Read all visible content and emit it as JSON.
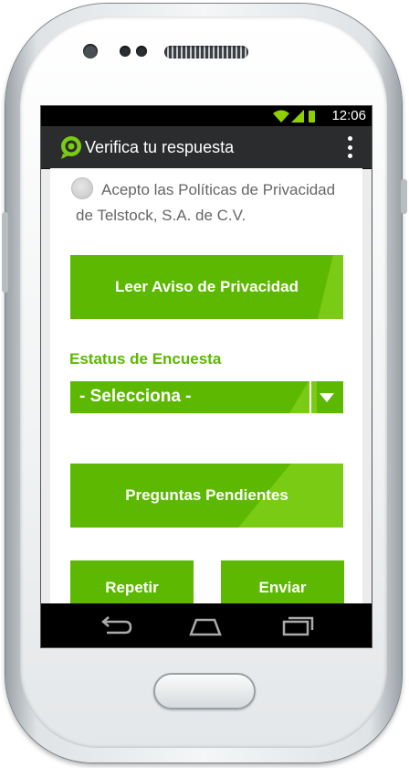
{
  "status_bar": {
    "time": "12:06"
  },
  "action_bar": {
    "title": "Verifica tu respuesta",
    "logo": "chat-bubble-logo-icon",
    "menu_icon": "overflow-menu-icon"
  },
  "consent": {
    "text": "Acepto las Políticas de Privacidad de Telstock, S.A. de C.V.",
    "checked": false
  },
  "buttons": {
    "privacy": "Leer Aviso de Privacidad",
    "pending": "Preguntas Pendientes",
    "repeat": "Repetir",
    "send": "Enviar"
  },
  "survey_status": {
    "label": "Estatus de Encuesta",
    "selected": "- Selecciona -"
  },
  "colors": {
    "accent": "#5cb800",
    "accent_light": "#7acb14",
    "action_bar": "#2a2c2d"
  },
  "nav": {
    "back": "back-icon",
    "home": "home-icon",
    "recents": "recents-icon"
  }
}
